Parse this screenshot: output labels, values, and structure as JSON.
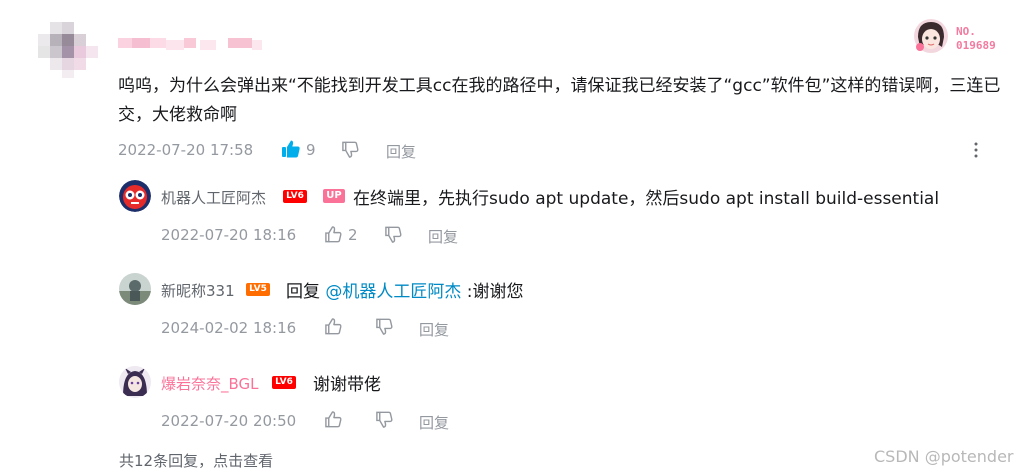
{
  "comment": {
    "text": "呜呜，为什么会弹出来“不能找到开发工具cc在我的路径中，请保证我已经安装了“gcc”软件包”这样的错误啊，三连已交，大佬救命啊",
    "time": "2022-07-20 17:58",
    "likes": "9",
    "reply_label": "回复",
    "badge_no_label": "NO.",
    "badge_no_value": "019689"
  },
  "replies": [
    {
      "name": "机器人工匠阿杰",
      "level": "LV6",
      "up": "UP",
      "text": "在终端里，先执行sudo apt update，然后sudo apt install build-essential",
      "time": "2022-07-20 18:16",
      "likes": "2",
      "reply_label": "回复"
    },
    {
      "name": "新昵称331",
      "level": "LV5",
      "text_prefix": "回复 ",
      "mention": "@机器人工匠阿杰",
      "text": " :谢谢您",
      "time": "2024-02-02 18:16",
      "likes": "",
      "reply_label": "回复"
    },
    {
      "name": "爆岩奈奈_BGL",
      "level": "LV6",
      "text": "谢谢带佬",
      "time": "2022-07-20 20:50",
      "likes": "",
      "reply_label": "回复"
    }
  ],
  "footer": {
    "more_replies": "共12条回复，点击查看"
  },
  "watermark": "CSDN @potender",
  "colors": {
    "lv6": "#ff0000",
    "lv5": "#ff6c00",
    "up": "#fb7299",
    "liked": "#00aeec",
    "mention": "#008ac5",
    "meta": "#9499a0",
    "pink_name": "#fb7299"
  }
}
